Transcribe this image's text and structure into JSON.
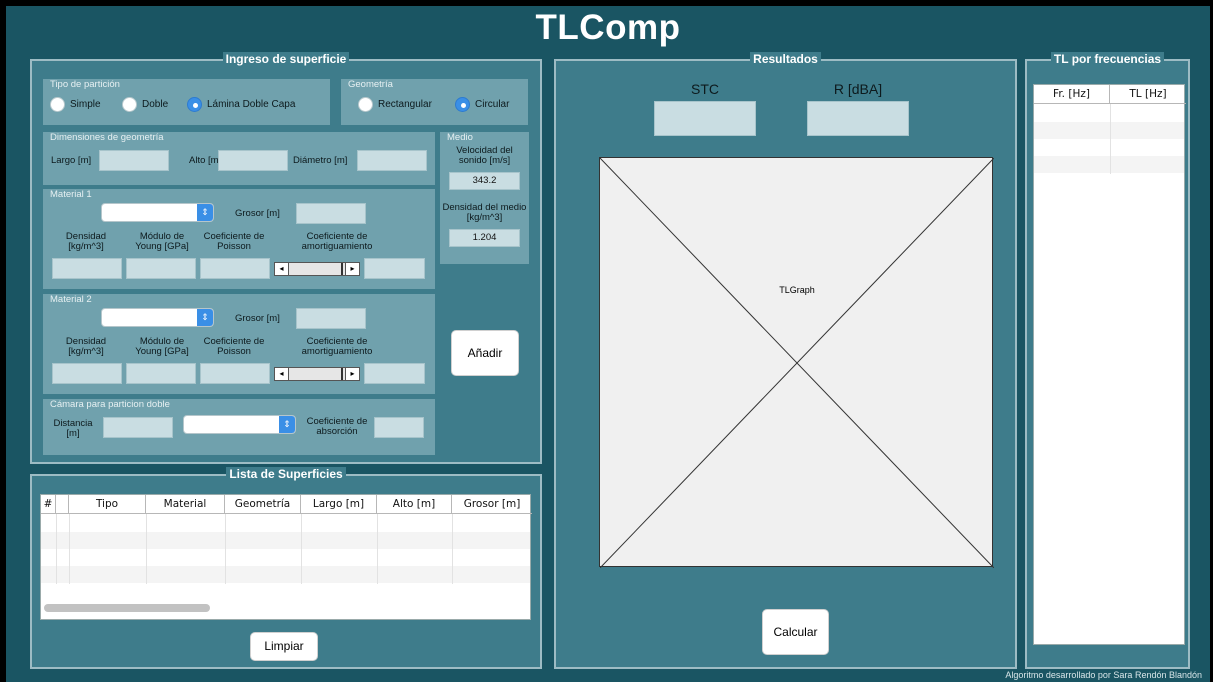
{
  "app": {
    "title": "TLComp",
    "footer": "Algoritmo desarrollado por Sara Rendón Blandón"
  },
  "ingreso": {
    "title": "Ingreso de superficie",
    "tipo": {
      "label": "Tipo de partición",
      "options": [
        "Simple",
        "Doble",
        "Lámina Doble Capa"
      ],
      "selected": "Lámina Doble Capa"
    },
    "geometria": {
      "label": "Geometría",
      "options": [
        "Rectangular",
        "Circular"
      ],
      "selected": "Circular"
    },
    "dimensiones": {
      "label": "Dimensiones de geometría",
      "largo": "Largo [m]",
      "alto": "Alto [m]",
      "diametro": "Diámetro [m]"
    },
    "medio": {
      "label": "Medio",
      "velocidad_label": "Velocidad del sonido [m/s]",
      "velocidad": "343.2",
      "densidad_label": "Densidad del medio [kg/m^3]",
      "densidad": "1.204"
    },
    "material1": {
      "label": "Material 1",
      "grosor": "Grosor [m]",
      "densidad": "Densidad [kg/m^3]",
      "young": "Módulo de Young [GPa]",
      "poisson": "Coeficiente de Poisson",
      "amort": "Coeficiente de amortiguamiento"
    },
    "material2": {
      "label": "Material 2",
      "grosor": "Grosor [m]",
      "densidad": "Densidad [kg/m^3]",
      "young": "Módulo de Young [GPa]",
      "poisson": "Coeficiente de Poisson",
      "amort": "Coeficiente de amortiguamiento"
    },
    "camara": {
      "label": "Cámara para particion doble",
      "distancia": "Distancia [m]",
      "absorcion": "Coeficiente de absorción"
    },
    "anadir": "Añadir"
  },
  "lista": {
    "title": "Lista de Superficies",
    "columns": [
      "#",
      "Tipo",
      "Material",
      "Geometría",
      "Largo [m]",
      "Alto [m]",
      "Grosor [m]"
    ],
    "limpiar": "Limpiar"
  },
  "resultados": {
    "title": "Resultados",
    "stc": "STC",
    "rdba": "R [dBA]",
    "graph": "TLGraph",
    "calcular": "Calcular"
  },
  "frecuencias": {
    "title": "TL por frecuencias",
    "columns": [
      "Fr. [Hz]",
      "TL [Hz]"
    ]
  },
  "colors": {
    "background": "#1a5563",
    "panel": "#3e7c8b",
    "group": "#70a1ad",
    "accent": "#3a8fe6"
  }
}
